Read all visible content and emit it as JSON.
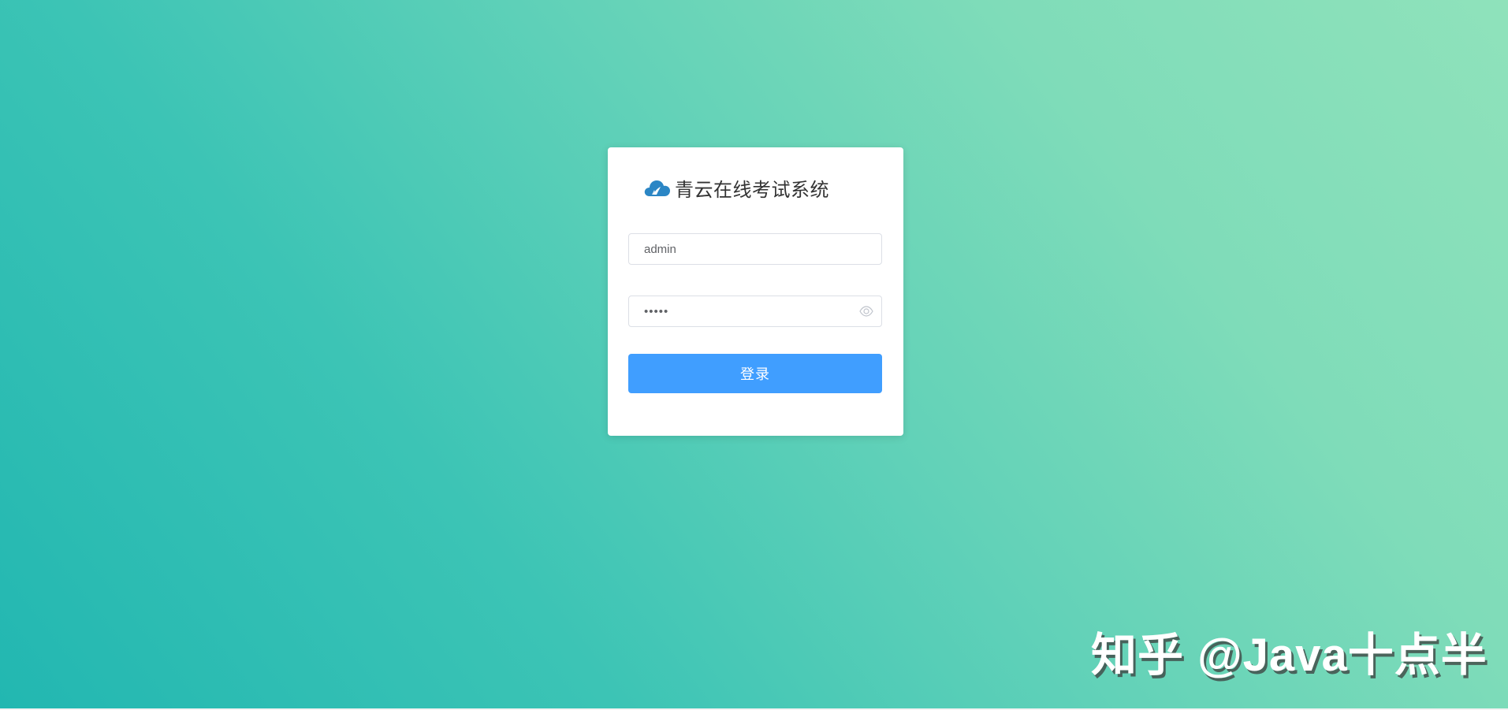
{
  "app": {
    "title": "青云在线考试系统",
    "logo_icon": "cloud-logo-icon"
  },
  "form": {
    "username_value": "admin",
    "password_value": "•••••",
    "password_toggle_icon": "eye-icon",
    "login_label": "登录"
  },
  "watermark": {
    "text": "知乎 @Java十点半"
  },
  "colors": {
    "background_start": "#22b7b1",
    "background_end": "#8fe2bb",
    "primary_button": "#409eff",
    "logo_blue": "#2b86c5"
  }
}
